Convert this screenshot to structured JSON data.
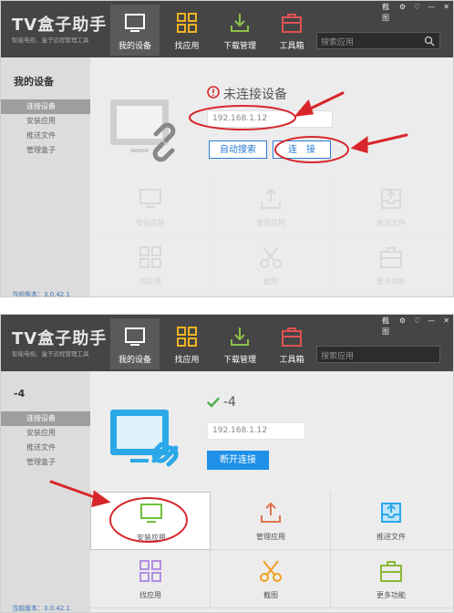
{
  "screens": [
    {
      "header": {
        "brand": "TV盒子助手",
        "tagline": "智能电视、盒子远程管理工具",
        "nav": [
          {
            "label": "我的设备",
            "icon": "tv-icon",
            "active": true
          },
          {
            "label": "找应用",
            "icon": "apps-grid-icon"
          },
          {
            "label": "下载管理",
            "icon": "download-icon"
          },
          {
            "label": "工具箱",
            "icon": "toolbox-icon"
          }
        ],
        "search_placeholder": "搜索应用",
        "window_controls": [
          "截图",
          "⚙",
          "♡",
          "—",
          "✕"
        ]
      },
      "sidebar": {
        "title": "我的设备",
        "items": [
          "连接设备",
          "安装应用",
          "推送文件",
          "管理盒子"
        ],
        "version": "当前版本：3.0.42.1"
      },
      "main": {
        "status_text": "未连接设备",
        "ip_value": "192.168.1.12",
        "auto_search_label": "自动搜索",
        "connect_label": "连　接",
        "grid": [
          "安装应用",
          "管理应用",
          "推送文件",
          "找应用",
          "截图",
          "更多功能"
        ]
      }
    },
    {
      "header": {
        "brand": "TV盒子助手",
        "tagline": "智能电视、盒子远程管理工具",
        "nav": [
          {
            "label": "我的设备",
            "icon": "tv-icon",
            "active": true
          },
          {
            "label": "找应用",
            "icon": "apps-grid-icon"
          },
          {
            "label": "下载管理",
            "icon": "download-icon"
          },
          {
            "label": "工具箱",
            "icon": "toolbox-icon"
          }
        ],
        "search_placeholder": "搜索应用",
        "window_controls": [
          "截图",
          "⚙",
          "♡",
          "—",
          "✕"
        ]
      },
      "sidebar": {
        "title": "-4",
        "items": [
          "连接设备",
          "安装应用",
          "推送文件",
          "管理盒子"
        ],
        "version": "当前版本：3.0.42.1"
      },
      "main": {
        "status_text": "-4",
        "ip_value": "192.168.1.12",
        "disconnect_label": "断开连接",
        "grid": [
          "安装应用",
          "管理应用",
          "推送文件",
          "找应用",
          "截图",
          "更多功能"
        ]
      }
    }
  ],
  "colors": {
    "accent": "#1e90e8",
    "annotation": "#d7262b",
    "header": "#454545",
    "connected": "#4caf50"
  }
}
